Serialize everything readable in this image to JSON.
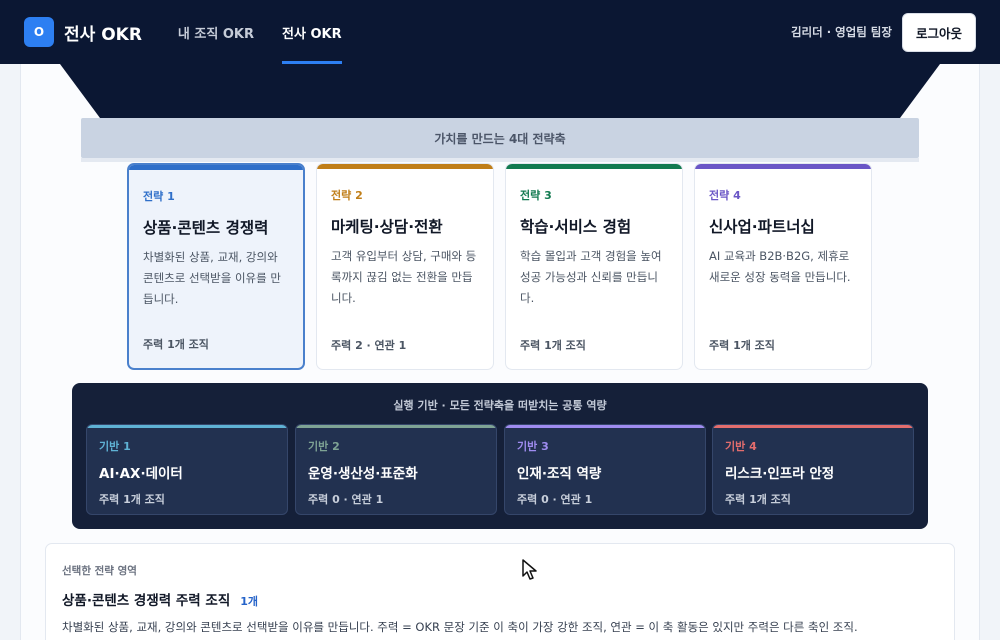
{
  "header": {
    "logo": "O",
    "brand": "전사 OKR",
    "tabs": [
      {
        "label": "내 조직 OKR",
        "active": false
      },
      {
        "label": "전사 OKR",
        "active": true
      }
    ],
    "user": "김리더 · 영업팀 팀장",
    "logout": "로그아웃"
  },
  "strategy_roof": {
    "title": "가치를 만드는 4대 전략축"
  },
  "pillars": [
    {
      "tag": "전략 1",
      "title": "상품·콘텐츠 경쟁력",
      "description": "차별화된 상품, 교재, 강의와 콘텐츠로 선택받을 이유를 만듭니다.",
      "summary": "주력 1개 조직",
      "color": "#2f6fc9",
      "selected": true
    },
    {
      "tag": "전략 2",
      "title": "마케팅·상담·전환",
      "description": "고객 유입부터 상담, 구매와 등록까지 끊김 없는 전환을 만듭니다.",
      "summary": "주력 2 · 연관 1",
      "color": "#c07e18",
      "selected": false
    },
    {
      "tag": "전략 3",
      "title": "학습·서비스 경험",
      "description": "학습 몰입과 고객 경험을 높여 성공 가능성과 신뢰를 만듭니다.",
      "summary": "주력 1개 조직",
      "color": "#127a50",
      "selected": false
    },
    {
      "tag": "전략 4",
      "title": "신사업·파트너십",
      "description": "AI 교육과 B2B·B2G, 제휴로 새로운 성장 동력을 만듭니다.",
      "summary": "주력 1개 조직",
      "color": "#6a56c6",
      "selected": false
    }
  ],
  "foundation": {
    "title": "실행 기반 · 모든 전략축을 떠받치는 공통 역량",
    "items": [
      {
        "tag": "기반 1",
        "name": "AI·AX·데이터",
        "summary": "주력 1개 조직",
        "color": "#5fb2d4"
      },
      {
        "tag": "기반 2",
        "name": "운영·생산성·표준화",
        "summary": "주력 0 · 연관 1",
        "color": "#7ea394"
      },
      {
        "tag": "기반 3",
        "name": "인재·조직 역량",
        "summary": "주력 0 · 연관 1",
        "color": "#9f8cf0"
      },
      {
        "tag": "기반 4",
        "name": "리스크·인프라 안정",
        "summary": "주력 1개 조직",
        "color": "#e36d6d"
      }
    ]
  },
  "detail": {
    "label": "선택한 전략 영역",
    "title": "상품·콘텐츠 경쟁력 주력 조직",
    "count": "1개",
    "description": "차별화된 상품, 교재, 강의와 콘텐츠로 선택받을 이유를 만듭니다. 주력 = OKR 문장 기준 이 축이 가장 강한 조직, 연관 = 이 축 활동은 있지만 주력은 다른 축인 조직."
  }
}
